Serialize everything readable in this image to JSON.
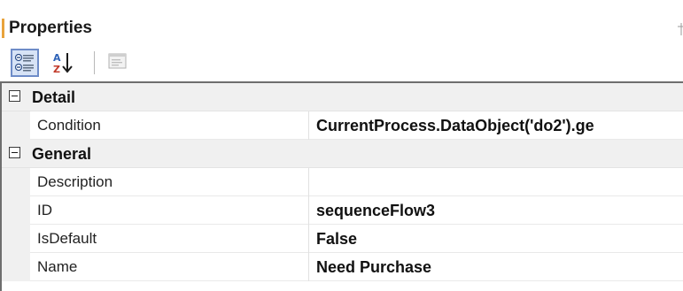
{
  "panel": {
    "title": "Properties",
    "accent_color": "#e8a33c"
  },
  "toolbar": {
    "buttons": [
      {
        "name": "categorized",
        "icon": "categorized-view-icon",
        "active": true
      },
      {
        "name": "alphabetical",
        "icon": "sort-az-icon",
        "active": false
      },
      {
        "name": "property-pages",
        "icon": "property-pages-icon",
        "active": false,
        "disabled": true
      }
    ]
  },
  "grid": {
    "categories": [
      {
        "label": "Detail",
        "expanded": true,
        "properties": [
          {
            "name": "Condition",
            "value": "CurrentProcess.DataObject('do2').ge"
          }
        ]
      },
      {
        "label": "General",
        "expanded": true,
        "properties": [
          {
            "name": "Description",
            "value": ""
          },
          {
            "name": "ID",
            "value": "sequenceFlow3"
          },
          {
            "name": "IsDefault",
            "value": "False"
          },
          {
            "name": "Name",
            "value": "Need Purchase"
          }
        ]
      }
    ]
  }
}
